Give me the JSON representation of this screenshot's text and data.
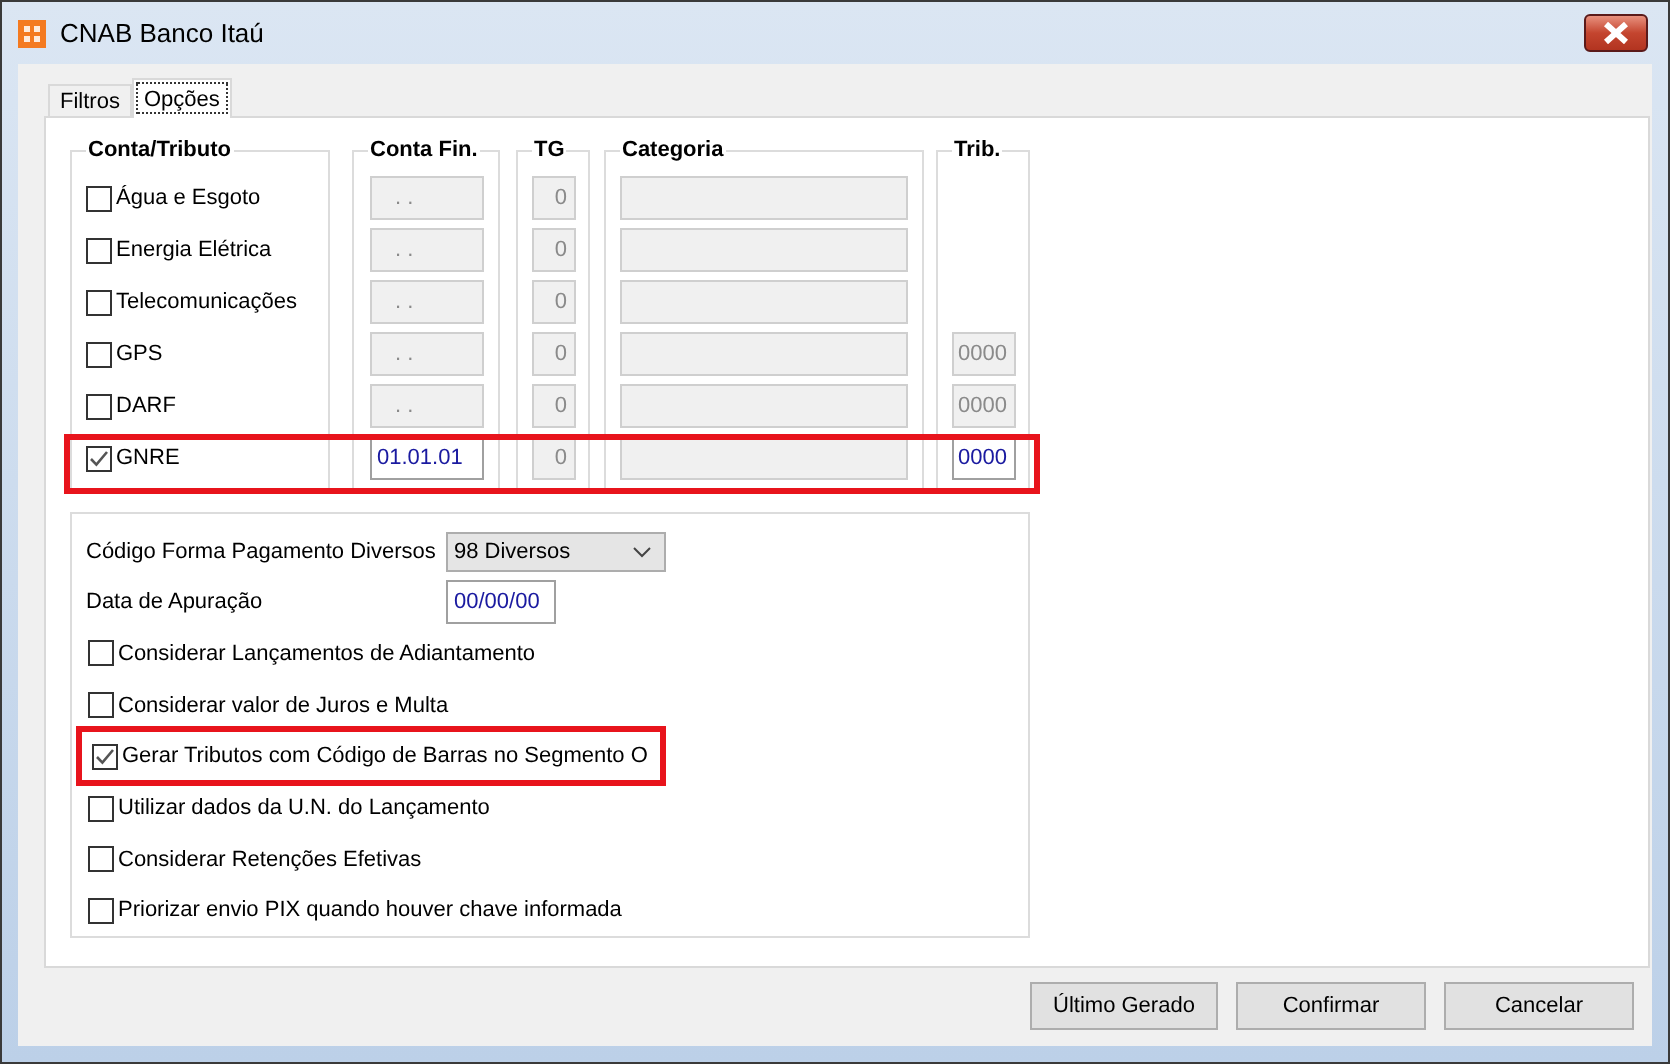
{
  "window": {
    "title": "CNAB Banco Itaú"
  },
  "tabs": [
    {
      "label": "Filtros",
      "selected": false
    },
    {
      "label": "Opções",
      "selected": true
    }
  ],
  "tax_table": {
    "columns": [
      "Conta/Tributo",
      "Conta Fin.",
      "TG",
      "Categoria",
      "Trib."
    ],
    "rows": [
      {
        "label": "Água e Esgoto",
        "checked": false,
        "highlighted": false,
        "conta_fin": ". .",
        "tg": "0"
      },
      {
        "label": "Energia Elétrica",
        "checked": false,
        "highlighted": false,
        "conta_fin": ". .",
        "tg": "0"
      },
      {
        "label": "Telecomunicações",
        "checked": false,
        "highlighted": false,
        "conta_fin": ". .",
        "tg": "0"
      },
      {
        "label": "GPS",
        "checked": false,
        "highlighted": false,
        "conta_fin": ". .",
        "tg": "0",
        "trib": "0000"
      },
      {
        "label": "DARF",
        "checked": false,
        "highlighted": false,
        "conta_fin": ". .",
        "tg": "0",
        "trib": "0000"
      },
      {
        "label": "GNRE",
        "checked": true,
        "highlighted": true,
        "conta_fin": "01.01.01",
        "tg": "0",
        "trib": "0000"
      }
    ]
  },
  "options": {
    "payment_code": {
      "label": "Código Forma Pagamento Diversos",
      "value": "98 Diversos"
    },
    "date": {
      "label": "Data de Apuração",
      "value": "00/00/00"
    },
    "checks": [
      {
        "label": "Considerar Lançamentos de Adiantamento",
        "checked": false,
        "highlighted": false
      },
      {
        "label": "Considerar valor de Juros e Multa",
        "checked": false,
        "highlighted": false
      },
      {
        "label": "Gerar Tributos com Código de Barras no Segmento O",
        "checked": true,
        "highlighted": true
      },
      {
        "label": "Utilizar dados da U.N. do Lançamento",
        "checked": false,
        "highlighted": false
      },
      {
        "label": "Considerar Retenções Efetivas",
        "checked": false,
        "highlighted": false
      },
      {
        "label": "Priorizar envio PIX quando houver chave informada",
        "checked": false,
        "highlighted": false
      }
    ]
  },
  "buttons": [
    "Último Gerado",
    "Confirmar",
    "Cancelar"
  ]
}
